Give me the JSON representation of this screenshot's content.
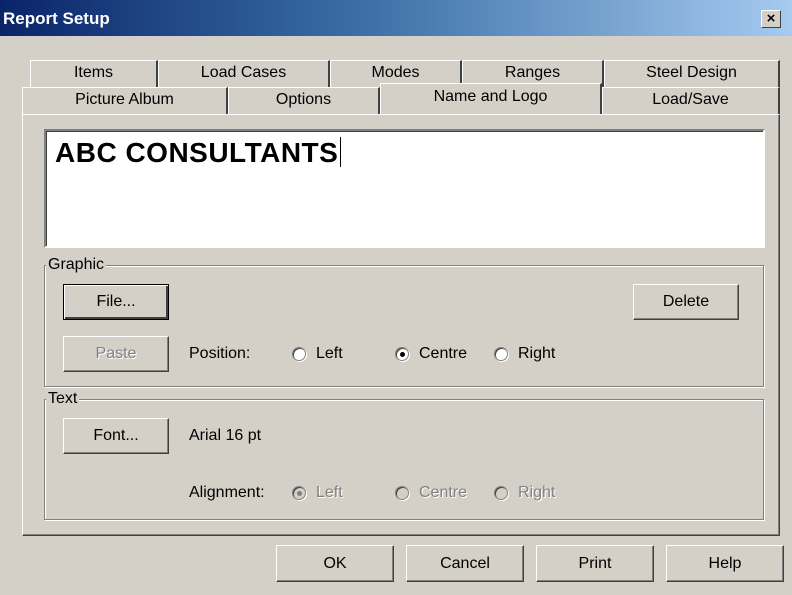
{
  "window": {
    "title": "Report Setup",
    "close_label": "×"
  },
  "tabs": {
    "row1": [
      "Items",
      "Load Cases",
      "Modes",
      "Ranges",
      "Steel Design"
    ],
    "row2": [
      "Picture Album",
      "Options",
      "Name and Logo",
      "Load/Save"
    ],
    "active": "Name and Logo"
  },
  "name_box": {
    "value": "ABC CONSULTANTS"
  },
  "graphic": {
    "legend": "Graphic",
    "file_button": "File...",
    "delete_button": "Delete",
    "paste_button": "Paste",
    "position_label": "Position:",
    "position_options": [
      "Left",
      "Centre",
      "Right"
    ],
    "position_selected": "Centre"
  },
  "text": {
    "legend": "Text",
    "font_button": "Font...",
    "font_value": "Arial 16 pt",
    "alignment_label": "Alignment:",
    "alignment_options": [
      "Left",
      "Centre",
      "Right"
    ],
    "alignment_selected": "Left"
  },
  "footer": {
    "ok": "OK",
    "cancel": "Cancel",
    "print": "Print",
    "help": "Help"
  }
}
